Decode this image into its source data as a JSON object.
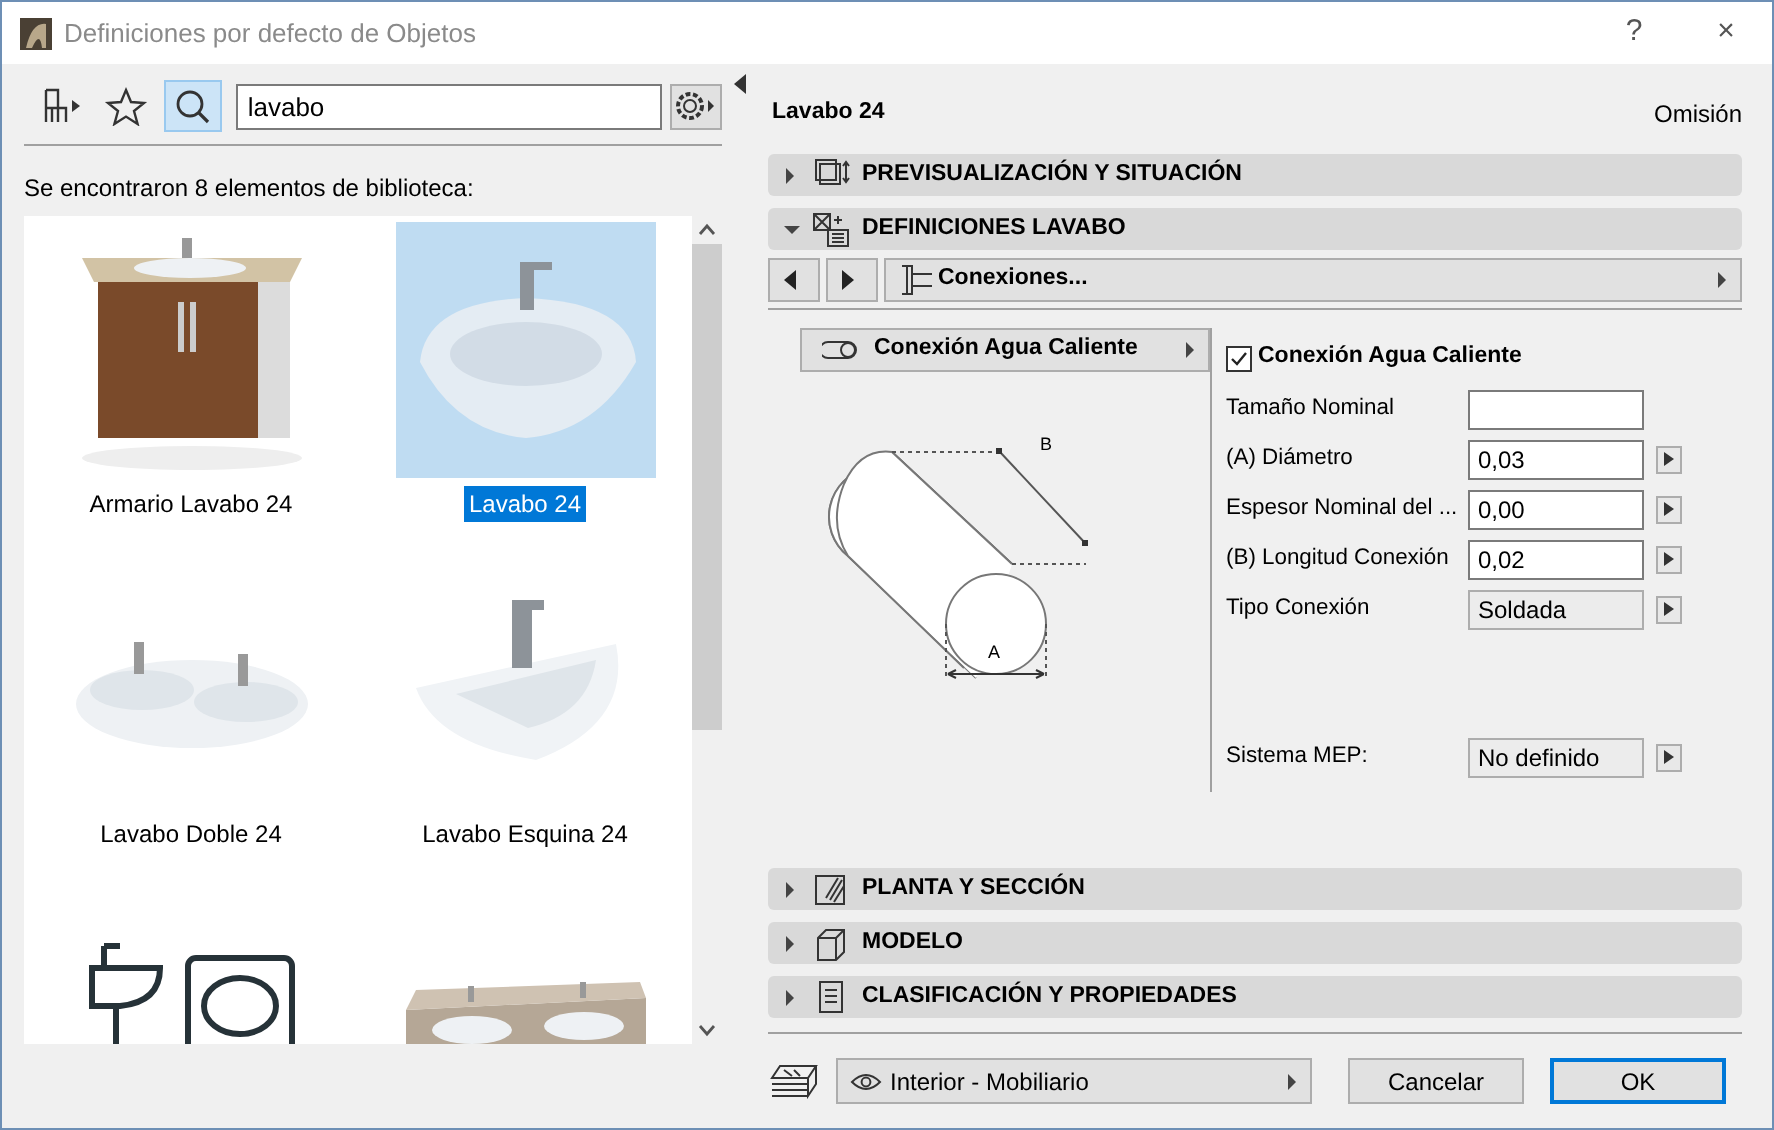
{
  "window": {
    "title": "Definiciones por defecto de Objetos",
    "controls": [
      "?",
      "×"
    ]
  },
  "library": {
    "tools": [
      {
        "kind": "chair",
        "selected": false
      },
      {
        "kind": "star",
        "selected": false
      },
      {
        "kind": "search",
        "selected": true
      }
    ],
    "search": {
      "value": "lavabo"
    },
    "result_text": "Se encontraron 8 elementos de biblioteca:",
    "items": [
      {
        "kind": "labeled",
        "label": "Armario Lavabo 24",
        "selected": false
      },
      {
        "kind": "labeled",
        "label": "Lavabo 24",
        "selected": true
      },
      {
        "kind": "labeled",
        "label": "Lavabo Doble 24",
        "selected": false
      },
      {
        "kind": "labeled",
        "label": "Lavabo Esquina 24",
        "selected": false
      },
      {
        "kind": "picture"
      },
      {
        "kind": "picture"
      }
    ]
  },
  "header": {
    "title": "Lavabo 24",
    "mode": "Omisión"
  },
  "sections": [
    {
      "title": "PREVISUALIZACIÓN Y SITUACIÓN",
      "expanded": false
    },
    {
      "title": "DEFINICIONES LAVABO",
      "expanded": true
    },
    {
      "title": "PLANTA Y SECCIÓN",
      "expanded": false
    },
    {
      "title": "MODELO",
      "expanded": false
    },
    {
      "title": "CLASIFICACIÓN Y PROPIEDADES",
      "expanded": false
    }
  ],
  "settings_panel": {
    "page": "Conexiones...",
    "connection_button": "Conexión Agua Caliente",
    "diagram_labels": [
      "B",
      "A"
    ],
    "enabled": {
      "label": "Conexión Agua Caliente",
      "checked": true
    },
    "params": [
      {
        "label": "Tamaño Nominal",
        "kind": "input",
        "arrow": false
      },
      {
        "label": "(A) Diámetro",
        "value": "0,03",
        "kind": "input",
        "arrow": true
      },
      {
        "label": "Espesor Nominal del ...",
        "value": "0,00",
        "kind": "input",
        "arrow": true
      },
      {
        "label": "(B) Longitud Conexión",
        "value": "0,02",
        "kind": "input",
        "arrow": true
      },
      {
        "label": "Tipo Conexión",
        "value": "Soldada",
        "kind": "choice",
        "arrow": true
      }
    ],
    "system": {
      "label": "Sistema MEP:",
      "value": "No definido",
      "kind": "choice",
      "arrow": true
    }
  },
  "footer": {
    "layer": "Interior - Mobiliario",
    "buttons": [
      {
        "label": "Cancelar",
        "default": false
      },
      {
        "label": "OK",
        "default": true
      }
    ]
  }
}
